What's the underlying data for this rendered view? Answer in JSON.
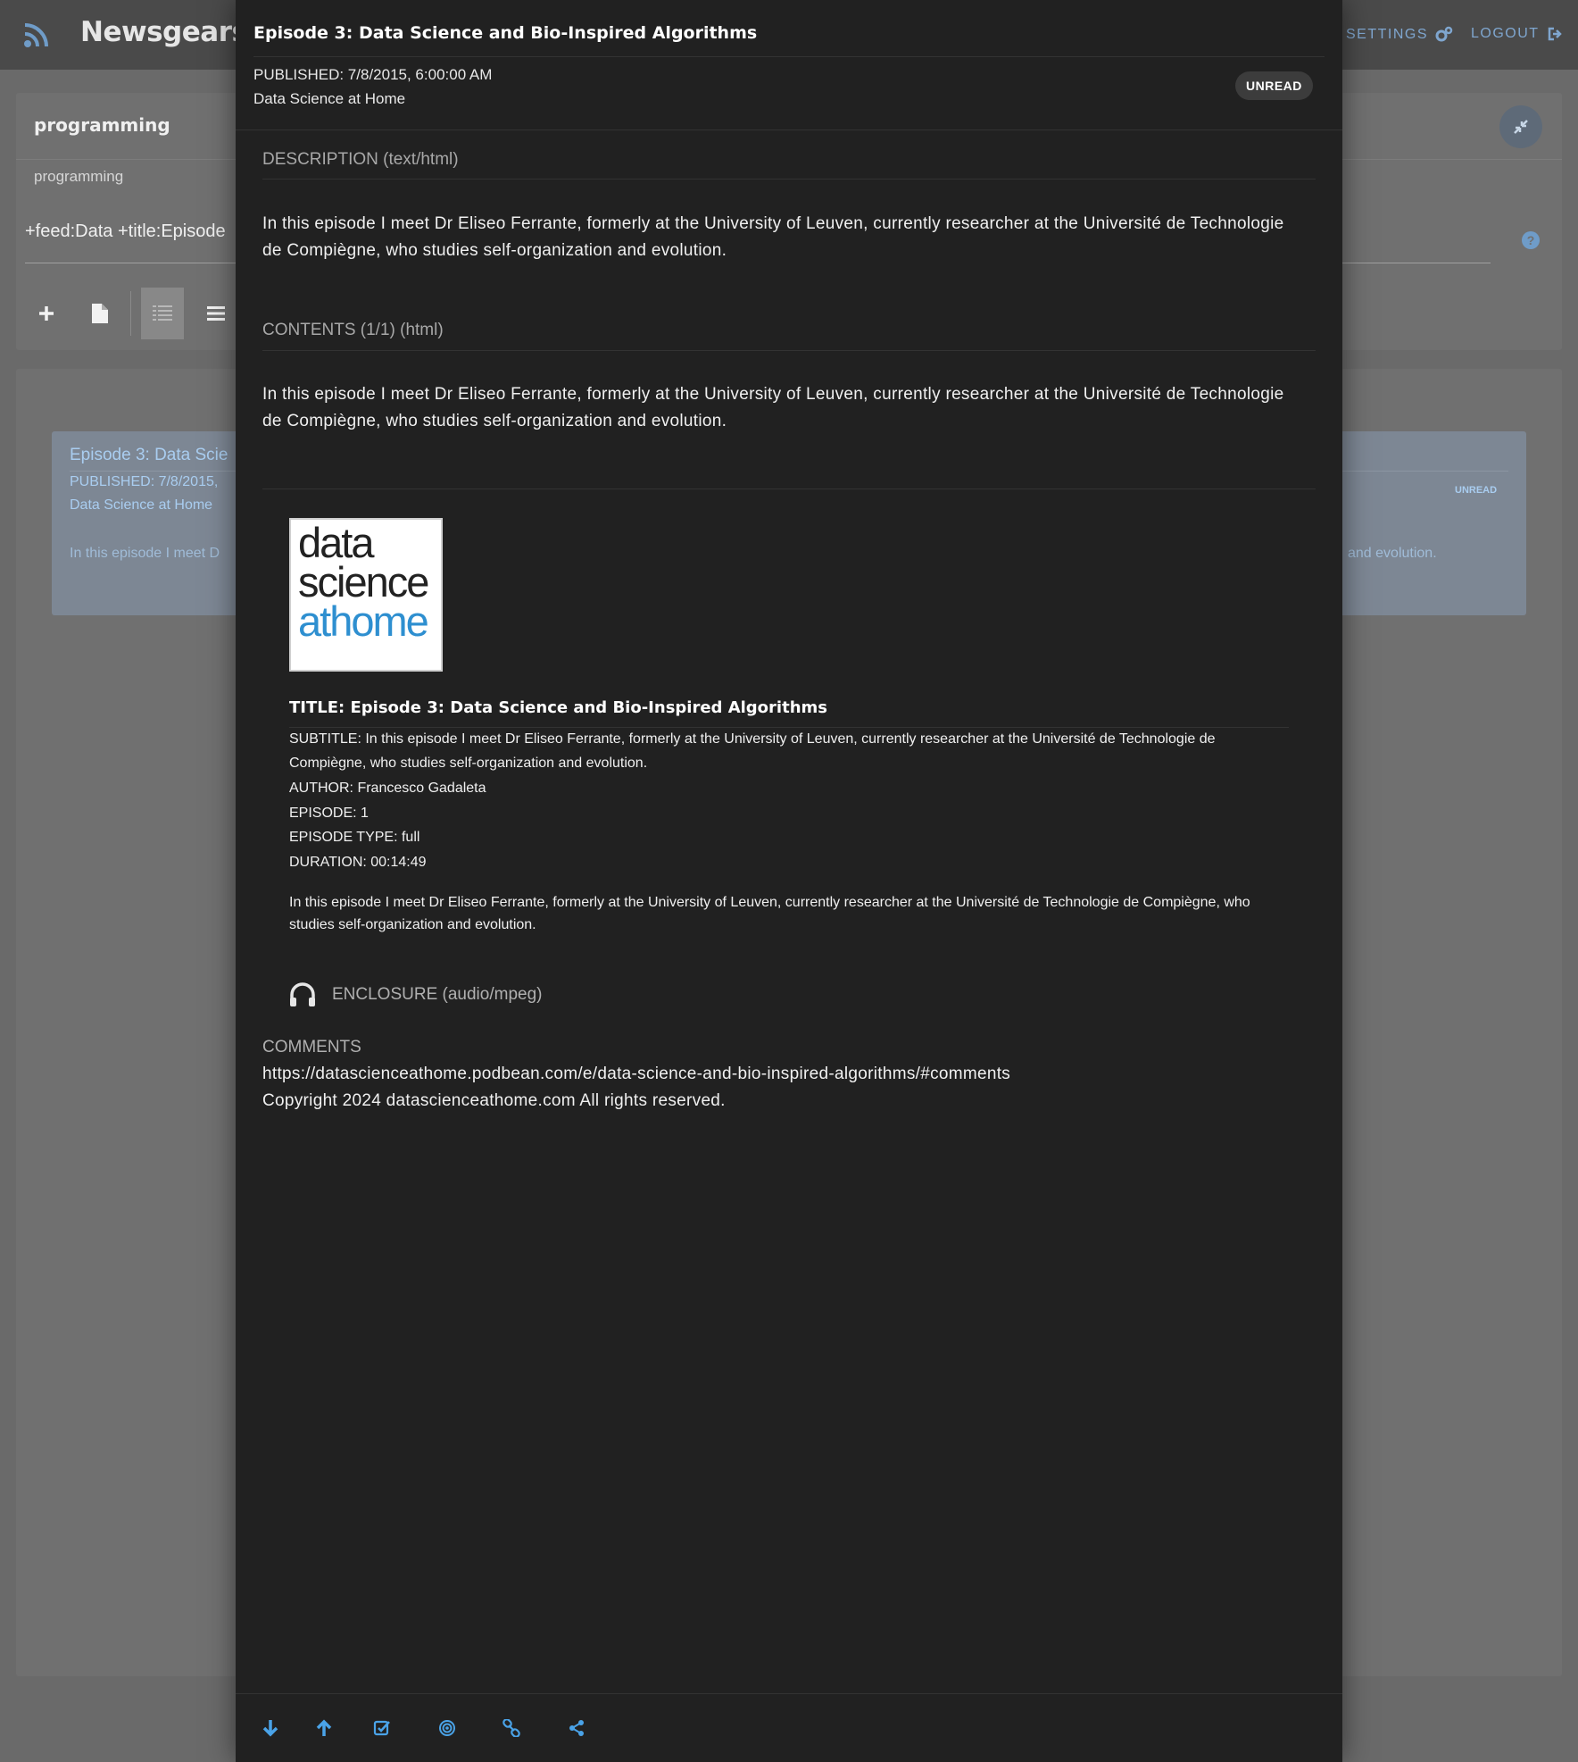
{
  "app": {
    "brand": "Newsgears",
    "nav": {
      "settings": "SETTINGS",
      "logout": "LOGOUT"
    }
  },
  "panel": {
    "title": "programming",
    "subtitle": "programming",
    "query": "+feed:Data +title:Episode"
  },
  "card": {
    "title": "Episode 3: Data Scie",
    "published": "PUBLISHED: 7/8/2015,",
    "feed": "Data Science at Home",
    "desc_left": "In this episode I meet D",
    "desc_right": "and evolution.",
    "badge": "UNREAD"
  },
  "modal": {
    "title": "Episode 3: Data Science and Bio-Inspired Algorithms",
    "published": "PUBLISHED: 7/8/2015, 6:00:00 AM",
    "feed": "Data Science at Home",
    "badge": "UNREAD",
    "description_heading": "DESCRIPTION (text/html)",
    "description_text": "In this episode I meet Dr Eliseo Ferrante, formerly at the University of Leuven, currently researcher at the Université de Technologie de Compiègne, who studies self-organization and evolution.",
    "contents_heading": "CONTENTS (1/1) (html)",
    "contents_text": "In this episode I meet Dr Eliseo Ferrante, formerly at the University of Leuven, currently researcher at the Université de Technologie de Compiègne, who studies self-organization and evolution.",
    "thumb": {
      "line1": "data",
      "line2": "science",
      "line3": "athome"
    },
    "item": {
      "title": "TITLE: Episode 3: Data Science and Bio-Inspired Algorithms",
      "subtitle": "SUBTITLE: In this episode I meet Dr Eliseo Ferrante, formerly at the University of Leuven, currently researcher at the Université de Technologie de Compiègne, who studies self-organization and evolution.",
      "author": "AUTHOR: Francesco Gadaleta",
      "episode": "EPISODE: 1",
      "episode_type": "EPISODE TYPE: full",
      "duration": "DURATION: 00:14:49",
      "summary": "In this episode I meet Dr Eliseo Ferrante, formerly at the University of Leuven, currently researcher at the Université de Technologie de Compiègne, who studies self-organization and evolution."
    },
    "enclosure": "ENCLOSURE (audio/mpeg)",
    "comments_heading": "COMMENTS",
    "comments_url": "https://datascienceathome.podbean.com/e/data-science-and-bio-inspired-algorithms/#comments",
    "copyright": "Copyright 2024 datascienceathome.com All rights reserved."
  },
  "colors": {
    "accent": "#4aa3e8",
    "modal_bg": "#212121",
    "overlay_bg": "#6a6a6a"
  },
  "icons": {
    "footer": [
      "arrow-down-icon",
      "arrow-up-icon",
      "check-square-icon",
      "target-icon",
      "link-icon",
      "share-icon"
    ]
  }
}
